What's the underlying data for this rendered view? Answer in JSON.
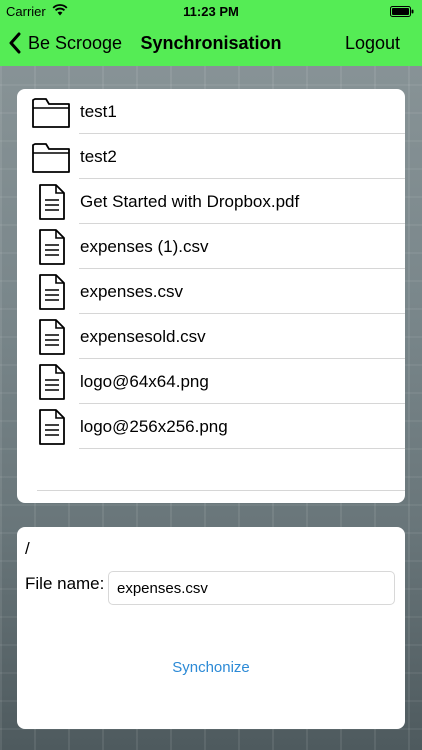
{
  "status_bar": {
    "carrier": "Carrier",
    "time": "11:23 PM"
  },
  "nav": {
    "back_label": "Be Scrooge",
    "title": "Synchronisation",
    "logout_label": "Logout",
    "bar_color": "#55ec55"
  },
  "files": [
    {
      "name": "test1",
      "icon": "folder-icon"
    },
    {
      "name": "test2",
      "icon": "folder-icon"
    },
    {
      "name": "Get Started with Dropbox.pdf",
      "icon": "document-icon"
    },
    {
      "name": "expenses (1).csv",
      "icon": "document-icon"
    },
    {
      "name": "expenses.csv",
      "icon": "document-icon"
    },
    {
      "name": "expensesold.csv",
      "icon": "document-icon"
    },
    {
      "name": "logo@64x64.png",
      "icon": "document-icon"
    },
    {
      "name": "logo@256x256.png",
      "icon": "document-icon"
    }
  ],
  "form": {
    "path": "/",
    "file_name_label": "File name:",
    "file_name_value": "expenses.csv",
    "sync_label": "Synchonize",
    "sync_color": "#2c8ad6"
  }
}
